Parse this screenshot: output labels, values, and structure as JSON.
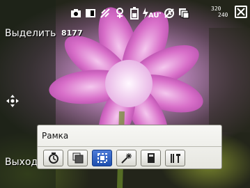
{
  "softkeys": {
    "select_label": "Выделить",
    "exit_label": "Выход"
  },
  "counter": "8177",
  "status": {
    "icons": [
      "camera-icon",
      "white-balance-icon",
      "brightness-icon",
      "macro-icon",
      "battery-icon",
      "flash-auto-icon",
      "self-timer-icon",
      "multi-shot-icon"
    ],
    "flash_text": "AUTO",
    "resolution_top": "320",
    "resolution_bottom": "240"
  },
  "popup": {
    "title": "Рамка",
    "items": [
      "self-timer-icon",
      "multi-shot-icon",
      "frame-icon",
      "effect-icon",
      "card-icon",
      "settings-icon"
    ],
    "selected_index": 2
  },
  "colors": {
    "selected_item": "#2a5bbf",
    "popup_background": "#eeeeea"
  }
}
